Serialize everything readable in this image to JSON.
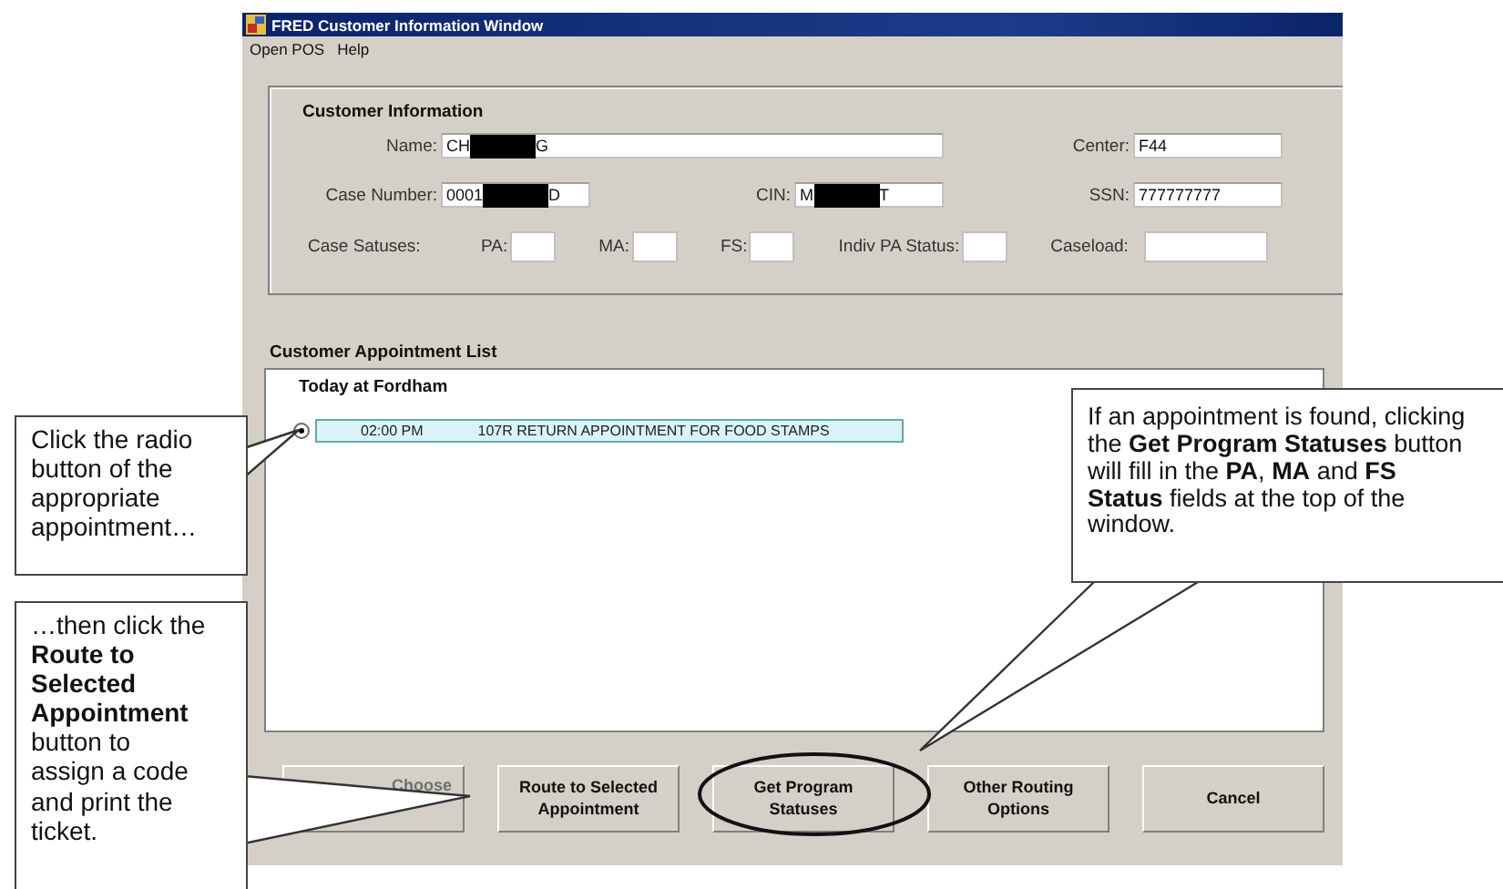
{
  "window": {
    "title": "FRED Customer Information Window"
  },
  "menu": [
    {
      "label": "Open POS"
    },
    {
      "label": "Help"
    }
  ],
  "customer_information": {
    "heading": "Customer Information",
    "fields": [
      {
        "label": "Name:",
        "value_start": "CH",
        "redacted": true,
        "value_end": "G"
      },
      {
        "label": "Center:",
        "value_start": "F44"
      },
      {
        "label": "Case Number:",
        "value_start": "0001",
        "redacted": true,
        "value_end": "D"
      },
      {
        "label": "CIN:",
        "value_start": "M",
        "redacted": true,
        "value_end": "T"
      },
      {
        "label": "SSN:",
        "value_start": "777777777"
      }
    ],
    "status_row": {
      "label": "Case Satuses:",
      "fields": [
        {
          "label": "PA:"
        },
        {
          "label": "MA:"
        },
        {
          "label": "FS:"
        },
        {
          "label": "Indiv PA Status:"
        },
        {
          "label": "Caseload:"
        }
      ]
    }
  },
  "appointment_list": {
    "heading": "Customer Appointment List",
    "group": "Today at Fordham",
    "appointments": [
      {
        "time": "02:00 PM",
        "description": "107R RETURN APPOINTMENT FOR FOOD STAMPS",
        "selected": true
      }
    ]
  },
  "buttons": [
    {
      "label": "Choose",
      "disabled": true
    },
    {
      "label": "Route to Selected Appointment",
      "disabled": false
    },
    {
      "label": "Get Program Statuses",
      "disabled": false
    },
    {
      "label": "Other Routing Options",
      "disabled": false
    },
    {
      "label": "Cancel",
      "disabled": false
    }
  ],
  "callouts": [
    {
      "text": "Click the radio button of the appropriate appointment…"
    },
    {
      "text": "…then click the **Route to Selected Appointment** button to assign a code and print the ticket."
    },
    {
      "text": "If an appointment is found, clicking the **Get Program Statuses** button will fill in the **PA**, **MA** and **FS Status** fields at the top of the window."
    }
  ]
}
